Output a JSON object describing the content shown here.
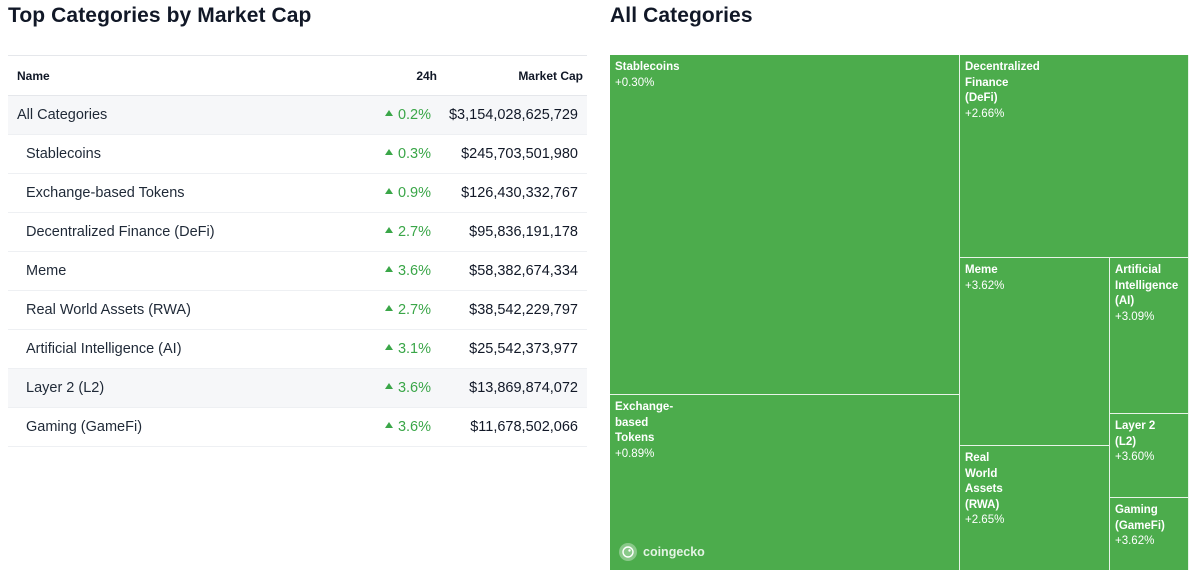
{
  "left_title": "Top Categories by Market Cap",
  "right_title": "All Categories",
  "table": {
    "headers": {
      "name": "Name",
      "change": "24h",
      "market_cap": "Market Cap"
    },
    "rows": [
      {
        "name": "All Categories",
        "change": "0.2%",
        "market_cap": "$3,154,028,625,729"
      },
      {
        "name": "Stablecoins",
        "change": "0.3%",
        "market_cap": "$245,703,501,980"
      },
      {
        "name": "Exchange-based Tokens",
        "change": "0.9%",
        "market_cap": "$126,430,332,767"
      },
      {
        "name": "Decentralized Finance (DeFi)",
        "change": "2.7%",
        "market_cap": "$95,836,191,178"
      },
      {
        "name": "Meme",
        "change": "3.6%",
        "market_cap": "$58,382,674,334"
      },
      {
        "name": "Real World Assets (RWA)",
        "change": "2.7%",
        "market_cap": "$38,542,229,797"
      },
      {
        "name": "Artificial Intelligence (AI)",
        "change": "3.1%",
        "market_cap": "$25,542,373,977"
      },
      {
        "name": "Layer 2 (L2)",
        "change": "3.6%",
        "market_cap": "$13,869,874,072"
      },
      {
        "name": "Gaming (GameFi)",
        "change": "3.6%",
        "market_cap": "$11,678,502,066"
      }
    ],
    "change_direction_icon": "caret-up-icon",
    "up_color": "#3aa648"
  },
  "treemap": {
    "tile_color": "#4cac4c",
    "tiles": [
      {
        "name": "Stablecoins",
        "change": "+0.30%"
      },
      {
        "name": "Decentralized\nFinance\n(DeFi)",
        "change": "+2.66%"
      },
      {
        "name": "Meme",
        "change": "+3.62%"
      },
      {
        "name": "Artificial\nIntelligence\n(AI)",
        "change": "+3.09%"
      },
      {
        "name": "Exchange-\nbased\nTokens",
        "change": "+0.89%"
      },
      {
        "name": "Real\nWorld\nAssets\n(RWA)",
        "change": "+2.65%"
      },
      {
        "name": "Layer 2\n(L2)",
        "change": "+3.60%"
      },
      {
        "name": "Gaming\n(GameFi)",
        "change": "+3.62%"
      }
    ],
    "watermark": "coingecko",
    "watermark_icon": "coingecko-logo-icon"
  }
}
